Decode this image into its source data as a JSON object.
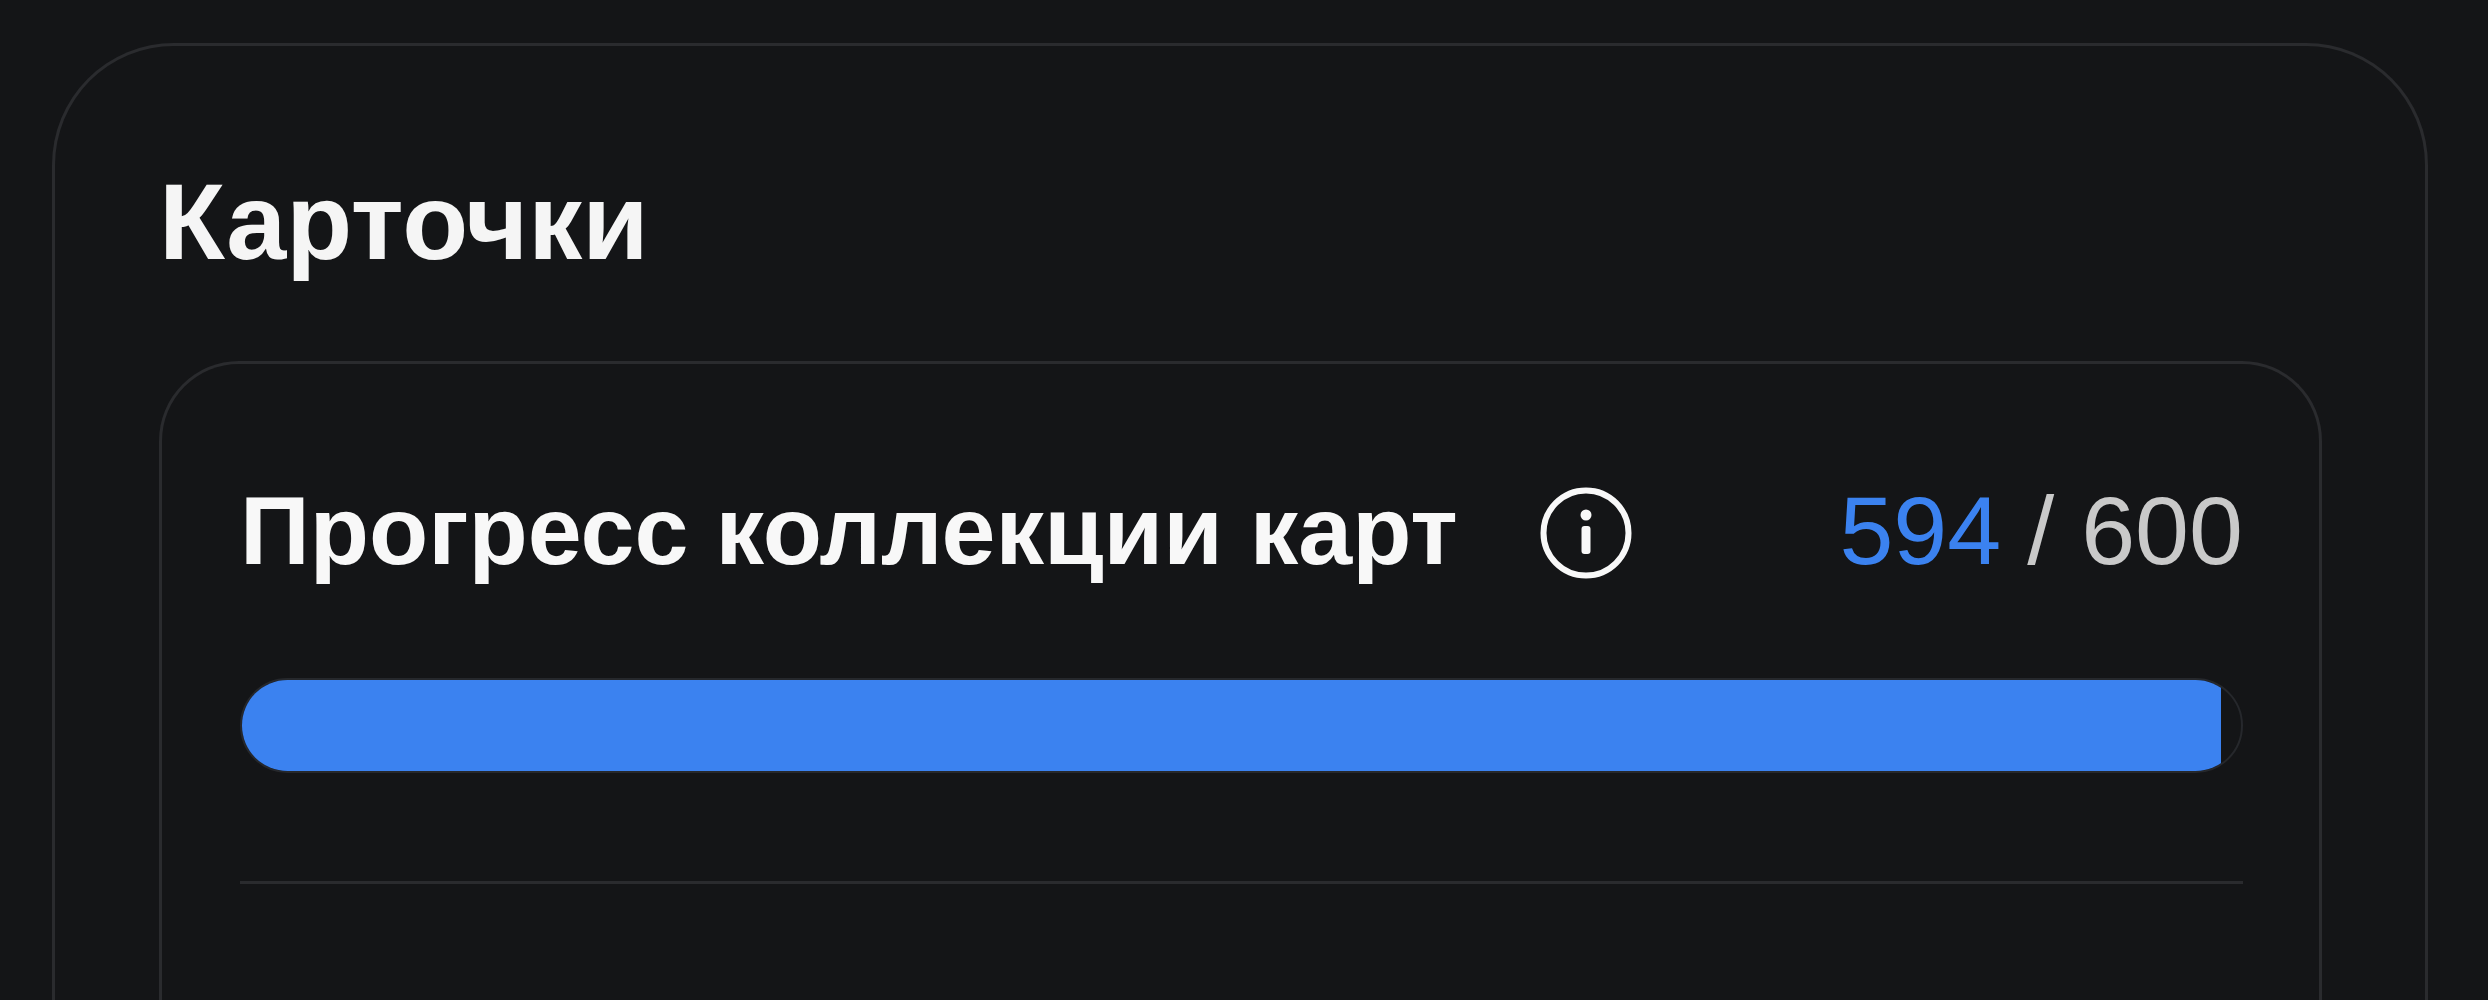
{
  "section": {
    "title": "Карточки"
  },
  "collection_progress": {
    "label": "Прогресс коллекции карт",
    "collected": "594",
    "total": "/ 600",
    "level": 0.99
  }
}
